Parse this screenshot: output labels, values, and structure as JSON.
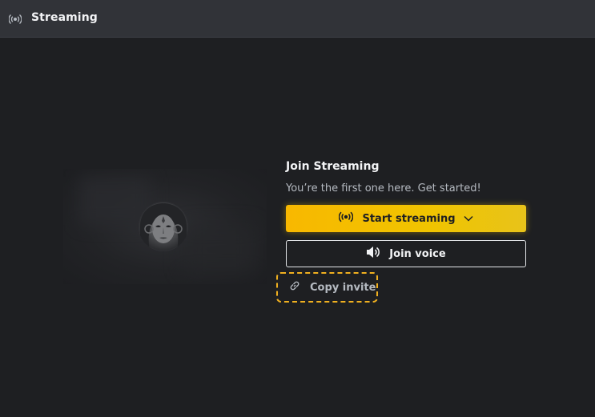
{
  "header": {
    "title": "Streaming",
    "icon": "broadcast-icon"
  },
  "main": {
    "title": "Join Streaming",
    "subtitle": "You’re the first one here. Get started!",
    "start_streaming_label": "Start streaming",
    "join_voice_label": "Join voice",
    "copy_invite_label": "Copy invite"
  },
  "colors": {
    "background": "#1e1f22",
    "header_bg": "#313338",
    "accent": "#f8b800",
    "focus_outline": "#f0b020"
  },
  "icons": {
    "header": "broadcast-icon",
    "start_streaming": "broadcast-icon",
    "start_streaming_dropdown": "chevron-down-icon",
    "join_voice": "speaker-icon",
    "copy_invite": "link-icon"
  }
}
